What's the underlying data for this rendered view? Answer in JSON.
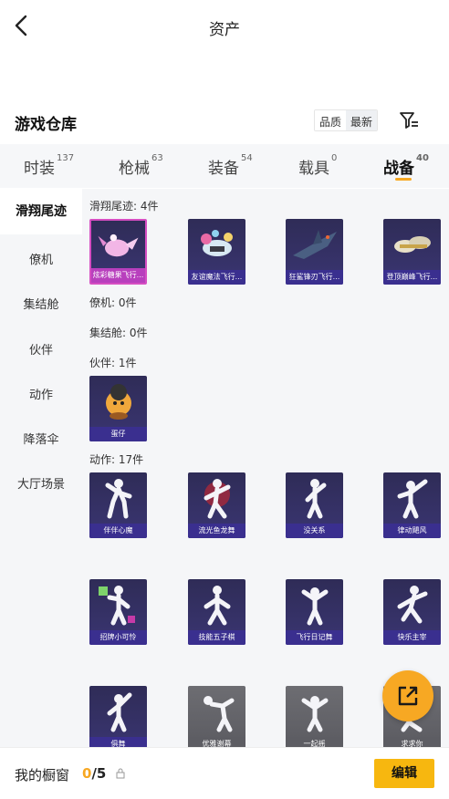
{
  "header": {
    "title": "资产"
  },
  "section": {
    "title": "游戏仓库"
  },
  "sort": {
    "options": [
      "品质",
      "最新"
    ]
  },
  "tabs": [
    {
      "label": "时装",
      "count": "137"
    },
    {
      "label": "枪械",
      "count": "63"
    },
    {
      "label": "装备",
      "count": "54"
    },
    {
      "label": "载具",
      "count": "0"
    },
    {
      "label": "战备",
      "count": "40"
    }
  ],
  "sidebar": {
    "items": [
      "滑翔尾迹",
      "僚机",
      "集结舱",
      "伙伴",
      "动作",
      "降落伞",
      "大厅场景"
    ]
  },
  "groups": {
    "trail": {
      "label": "滑翔尾迹: 4件",
      "items": [
        "炫彩糖果飞行...",
        "友谊魔法飞行...",
        "狂鲨锋刃飞行...",
        "登顶巅峰飞行..."
      ]
    },
    "wingman": {
      "label": "僚机: 0件"
    },
    "pod": {
      "label": "集结舱: 0件"
    },
    "partner": {
      "label": "伙伴: 1件",
      "items": [
        "蛋仔"
      ]
    },
    "emote": {
      "label": "动作: 17件",
      "items": [
        "伴伴心魔",
        "流光鱼龙舞",
        "没关系",
        "律动飓风",
        "招牌小可怜",
        "技能五子棋",
        "飞行日记舞",
        "快乐主宰",
        "俱舞",
        "优雅谢幕",
        "一起摇",
        "求求你"
      ]
    }
  },
  "bottom": {
    "label": "我的橱窗",
    "current": "0",
    "total": "/5",
    "edit_label": "编辑"
  },
  "colors": {
    "accent": "#f7a823",
    "card": "#2f2c57",
    "caption": "#3a2f8f",
    "pink": "#d64ec2"
  }
}
